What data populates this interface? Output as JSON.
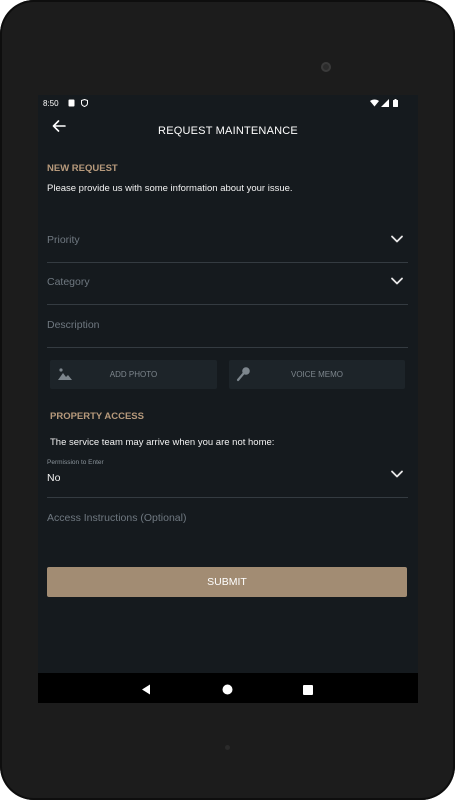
{
  "status_bar": {
    "time": "8:50"
  },
  "app_bar": {
    "title": "REQUEST MAINTENANCE",
    "back_icon": "arrow-left-icon"
  },
  "new_request": {
    "section_label": "NEW REQUEST",
    "intro_text": "Please provide us with some information about your issue.",
    "priority_placeholder": "Priority",
    "category_placeholder": "Category",
    "description_placeholder": "Description",
    "add_photo_label": "ADD PHOTO",
    "voice_memo_label": "VOICE MEMO"
  },
  "property_access": {
    "section_label": "PROPERTY ACCESS",
    "info_text": "The service team may arrive when you are not home:",
    "permission_label": "Permission to Enter",
    "permission_value": "No",
    "instructions_placeholder": "Access Instructions (Optional)"
  },
  "submit_label": "SUBMIT",
  "colors": {
    "accent": "#b79a7c",
    "button": "#a28c73",
    "background": "#151a1e"
  }
}
